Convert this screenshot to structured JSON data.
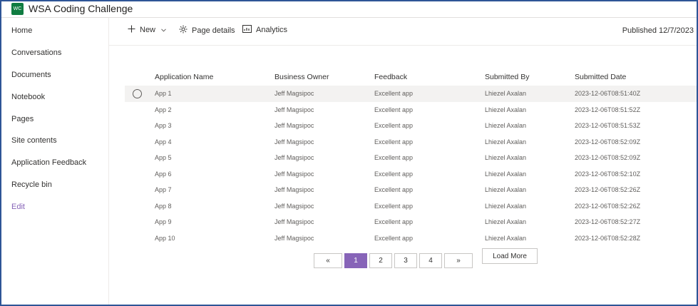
{
  "site": {
    "logo_text": "WC",
    "title": "WSA Coding Challenge"
  },
  "sidebar": {
    "items": [
      {
        "label": "Home"
      },
      {
        "label": "Conversations"
      },
      {
        "label": "Documents"
      },
      {
        "label": "Notebook"
      },
      {
        "label": "Pages"
      },
      {
        "label": "Site contents"
      },
      {
        "label": "Application Feedback"
      },
      {
        "label": "Recycle bin"
      },
      {
        "label": "Edit"
      }
    ]
  },
  "commandbar": {
    "new_label": "New",
    "page_details_label": "Page details",
    "analytics_label": "Analytics",
    "published": "Published 12/7/2023"
  },
  "table": {
    "columns": [
      "Application Name",
      "Business Owner",
      "Feedback",
      "Submitted By",
      "Submitted Date"
    ],
    "rows": [
      [
        "App 1",
        "Jeff Magsipoc",
        "Excellent app",
        "Lhiezel Axalan",
        "2023-12-06T08:51:40Z"
      ],
      [
        "App 2",
        "Jeff Magsipoc",
        "Excellent app",
        "Lhiezel Axalan",
        "2023-12-06T08:51:52Z"
      ],
      [
        "App 3",
        "Jeff Magsipoc",
        "Excellent app",
        "Lhiezel Axalan",
        "2023-12-06T08:51:53Z"
      ],
      [
        "App 4",
        "Jeff Magsipoc",
        "Excellent app",
        "Lhiezel Axalan",
        "2023-12-06T08:52:09Z"
      ],
      [
        "App 5",
        "Jeff Magsipoc",
        "Excellent app",
        "Lhiezel Axalan",
        "2023-12-06T08:52:09Z"
      ],
      [
        "App 6",
        "Jeff Magsipoc",
        "Excellent app",
        "Lhiezel Axalan",
        "2023-12-06T08:52:10Z"
      ],
      [
        "App 7",
        "Jeff Magsipoc",
        "Excellent app",
        "Lhiezel Axalan",
        "2023-12-06T08:52:26Z"
      ],
      [
        "App 8",
        "Jeff Magsipoc",
        "Excellent app",
        "Lhiezel Axalan",
        "2023-12-06T08:52:26Z"
      ],
      [
        "App 9",
        "Jeff Magsipoc",
        "Excellent app",
        "Lhiezel Axalan",
        "2023-12-06T08:52:27Z"
      ],
      [
        "App 10",
        "Jeff Magsipoc",
        "Excellent app",
        "Lhiezel Axalan",
        "2023-12-06T08:52:28Z"
      ]
    ]
  },
  "pagination": {
    "prev_label": "«",
    "next_label": "»",
    "pages": [
      "1",
      "2",
      "3",
      "4"
    ],
    "current_page": "1",
    "load_more_label": "Load More"
  },
  "colors": {
    "accent": "#8764b8",
    "logo_bg": "#107c41",
    "frame_border": "#2e5597"
  }
}
